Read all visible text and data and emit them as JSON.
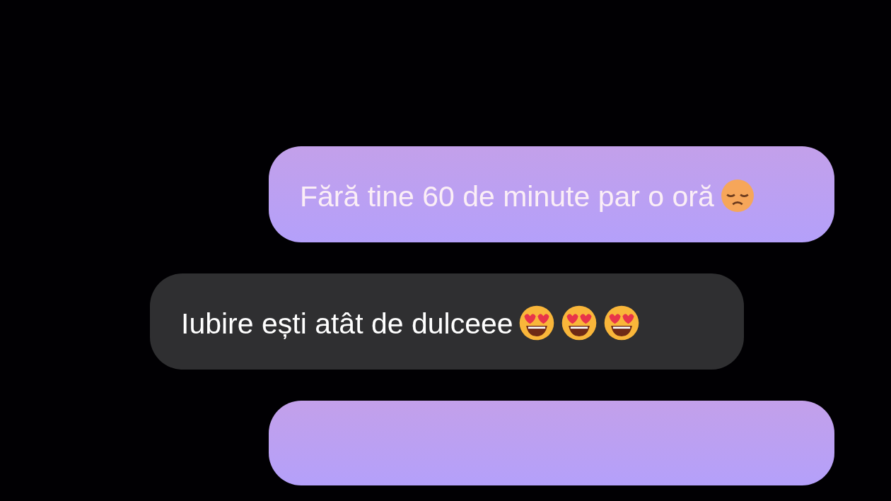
{
  "messages": [
    {
      "kind": "sent",
      "text": "Fără tine 60 de minute par o oră",
      "emojis": [
        {
          "kind": "sad"
        }
      ]
    },
    {
      "kind": "received",
      "text": "Iubire ești atât de dulceee",
      "emojis": [
        {
          "kind": "heart-eyes"
        },
        {
          "kind": "heart-eyes"
        },
        {
          "kind": "heart-eyes"
        }
      ]
    },
    {
      "kind": "sent"
    }
  ]
}
